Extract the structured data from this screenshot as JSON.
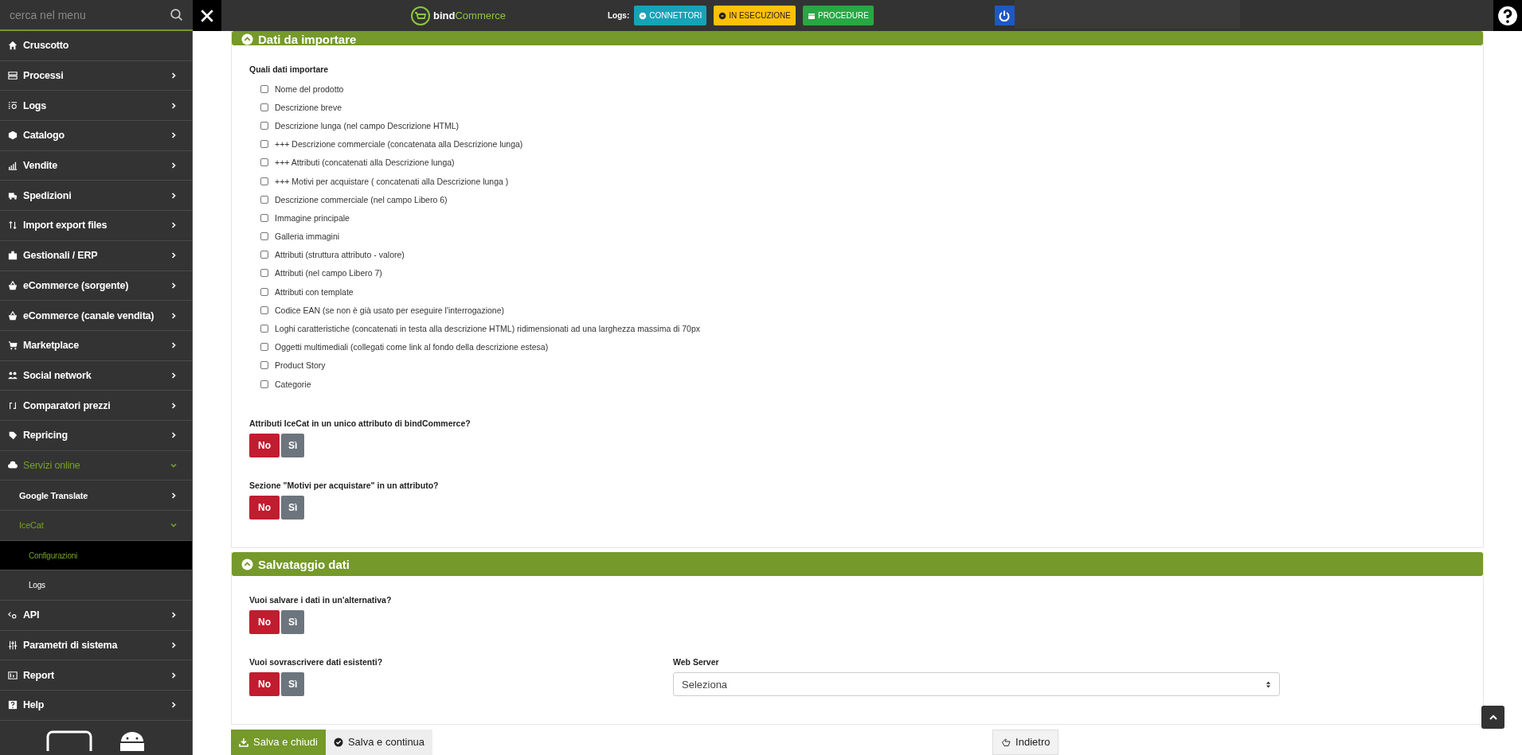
{
  "topbar": {
    "search": {
      "placeholder": "cerca nel menu"
    },
    "logo": {
      "brand_a": "bind",
      "brand_b": "Commerce"
    },
    "logs_label": "Logs:",
    "log_buttons": [
      {
        "kind": "info",
        "label": "CONNETTORI"
      },
      {
        "kind": "warning",
        "label": "IN ESECUZIONE"
      },
      {
        "kind": "success",
        "label": "PROCEDURE"
      }
    ]
  },
  "sidebar": {
    "items": [
      {
        "label": "Cruscotto",
        "selected": false
      },
      {
        "label": "Processi",
        "selected": false,
        "expanded": false
      },
      {
        "label": "Logs",
        "selected": false,
        "expanded": false
      },
      {
        "label": "Catalogo",
        "selected": false,
        "expanded": false
      },
      {
        "label": "Vendite",
        "selected": false,
        "expanded": false
      },
      {
        "label": "Spedizioni",
        "selected": false,
        "expanded": false
      },
      {
        "label": "Import export files",
        "selected": false,
        "expanded": false
      },
      {
        "label": "Gestionali / ERP",
        "selected": false,
        "expanded": false
      },
      {
        "label": "eCommerce (sorgente)",
        "selected": false,
        "expanded": false
      },
      {
        "label": "eCommerce (canale vendita)",
        "selected": false,
        "expanded": false
      },
      {
        "label": "Marketplace",
        "selected": false,
        "expanded": false
      },
      {
        "label": "Social network",
        "selected": false,
        "expanded": false
      },
      {
        "label": "Comparatori prezzi",
        "selected": false,
        "expanded": false
      },
      {
        "label": "Repricing",
        "selected": false,
        "expanded": false
      },
      {
        "label": "Servizi online",
        "selected": false,
        "expanded": true,
        "children": [
          {
            "label": "Google Translate",
            "selected": false,
            "expanded": false
          },
          {
            "label": "IceCat",
            "selected": false,
            "expanded": true,
            "children": [
              {
                "label": "Configurazioni",
                "selected": true
              },
              {
                "label": "Logs",
                "selected": false
              }
            ]
          }
        ]
      },
      {
        "label": "API",
        "selected": false,
        "expanded": false
      },
      {
        "label": "Parametri di sistema",
        "selected": false,
        "expanded": false
      },
      {
        "label": "Report",
        "selected": false,
        "expanded": false
      },
      {
        "label": "Help",
        "selected": false,
        "expanded": false
      }
    ]
  },
  "sections": [
    {
      "title": "Dati da importare",
      "expanded": true,
      "groups": [
        {
          "kind": "checklist",
          "label": "Quali dati importare",
          "options": [
            {
              "label": "Nome del prodotto",
              "checked": false
            },
            {
              "label": "Descrizione breve",
              "checked": false
            },
            {
              "label": "Descrizione lunga (nel campo Descrizione HTML)",
              "checked": false
            },
            {
              "label": "+++ Descrizione commerciale (concatenata alla Descrizione lunga)",
              "checked": false
            },
            {
              "label": "+++ Attributi (concatenati alla Descrizione lunga)",
              "checked": false
            },
            {
              "label": "+++ Motivi per acquistare ( concatenati alla Descrizione lunga )",
              "checked": false
            },
            {
              "label": "Descrizione commerciale (nel campo Libero 6)",
              "checked": false
            },
            {
              "label": "Immagine principale",
              "checked": false
            },
            {
              "label": "Galleria immagini",
              "checked": false
            },
            {
              "label": "Attributi (struttura attributo - valore)",
              "checked": false
            },
            {
              "label": "Attributi (nel campo Libero 7)",
              "checked": false
            },
            {
              "label": "Attributi con template",
              "checked": false
            },
            {
              "label": "Codice EAN (se non è già usato per eseguire l'interrogazione)",
              "checked": false
            },
            {
              "label": "Loghi caratteristiche (concatenati in testa alla descrizione HTML) ridimensionati ad una larghezza massima di 70px",
              "checked": false
            },
            {
              "label": "Oggetti multimediali (collegati come link al fondo della descrizione estesa)",
              "checked": false
            },
            {
              "label": "Product Story",
              "checked": false
            },
            {
              "label": "Categorie",
              "checked": false
            }
          ]
        },
        {
          "kind": "toggle",
          "label": "Attributi IceCat in un unico attributo di bindCommerce?",
          "options": [
            {
              "label": "No",
              "selected": true
            },
            {
              "label": "Sì",
              "selected": false
            }
          ]
        },
        {
          "kind": "toggle",
          "label": "Sezione \"Motivi per acquistare\" in un attributo?",
          "options": [
            {
              "label": "No",
              "selected": true
            },
            {
              "label": "Sì",
              "selected": false
            }
          ]
        }
      ]
    },
    {
      "title": "Salvataggio dati",
      "expanded": true,
      "groups": [
        {
          "kind": "toggle",
          "label": "Vuoi salvare i dati in un'alternativa?",
          "options": [
            {
              "label": "No",
              "selected": true
            },
            {
              "label": "Sì",
              "selected": false
            }
          ]
        },
        {
          "kind": "toggle",
          "label": "Vuoi sovrascrivere dati esistenti?",
          "options": [
            {
              "label": "No",
              "selected": true
            },
            {
              "label": "Sì",
              "selected": false
            }
          ],
          "side": {
            "label": "Web Server",
            "value": "Seleziona"
          }
        }
      ]
    }
  ],
  "footer": {
    "buttons": [
      {
        "kind": "primary",
        "label": "Salva e chiudi"
      },
      {
        "kind": "secondary",
        "label": "Salva e continua"
      },
      {
        "kind": "back",
        "label": "Indietro"
      }
    ]
  }
}
